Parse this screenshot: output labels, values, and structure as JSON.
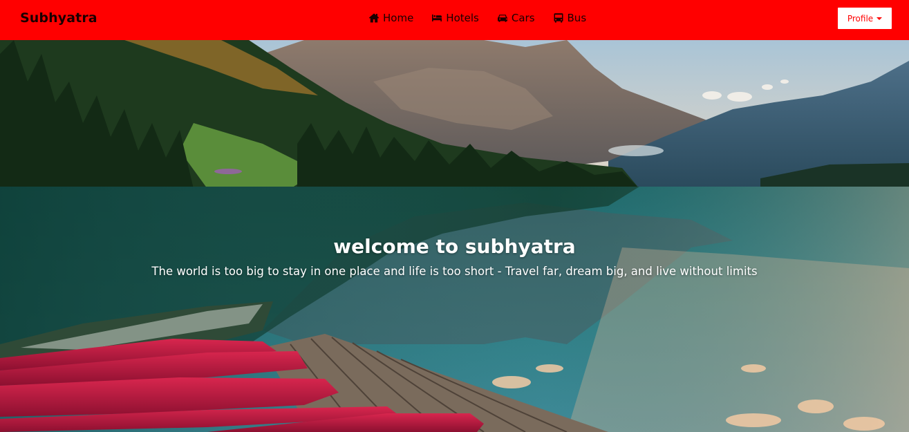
{
  "brand": "Subhyatra",
  "nav": {
    "items": [
      {
        "label": "Home",
        "icon": "home-icon"
      },
      {
        "label": "Hotels",
        "icon": "bed-icon"
      },
      {
        "label": "Cars",
        "icon": "car-icon"
      },
      {
        "label": "Bus",
        "icon": "bus-icon"
      }
    ],
    "profile_label": "Profile"
  },
  "hero": {
    "title": "welcome to subhyatra",
    "subtitle": "The world is too big to stay in one place and life is too short - Travel far, dream big, and live without limits",
    "background": "mountain-lake-with-red-canoes-on-dock"
  },
  "colors": {
    "navbar": "#ff0000",
    "profile_button_bg": "#ffffff",
    "profile_button_text": "#ff0000",
    "hero_text": "#ffffff"
  }
}
